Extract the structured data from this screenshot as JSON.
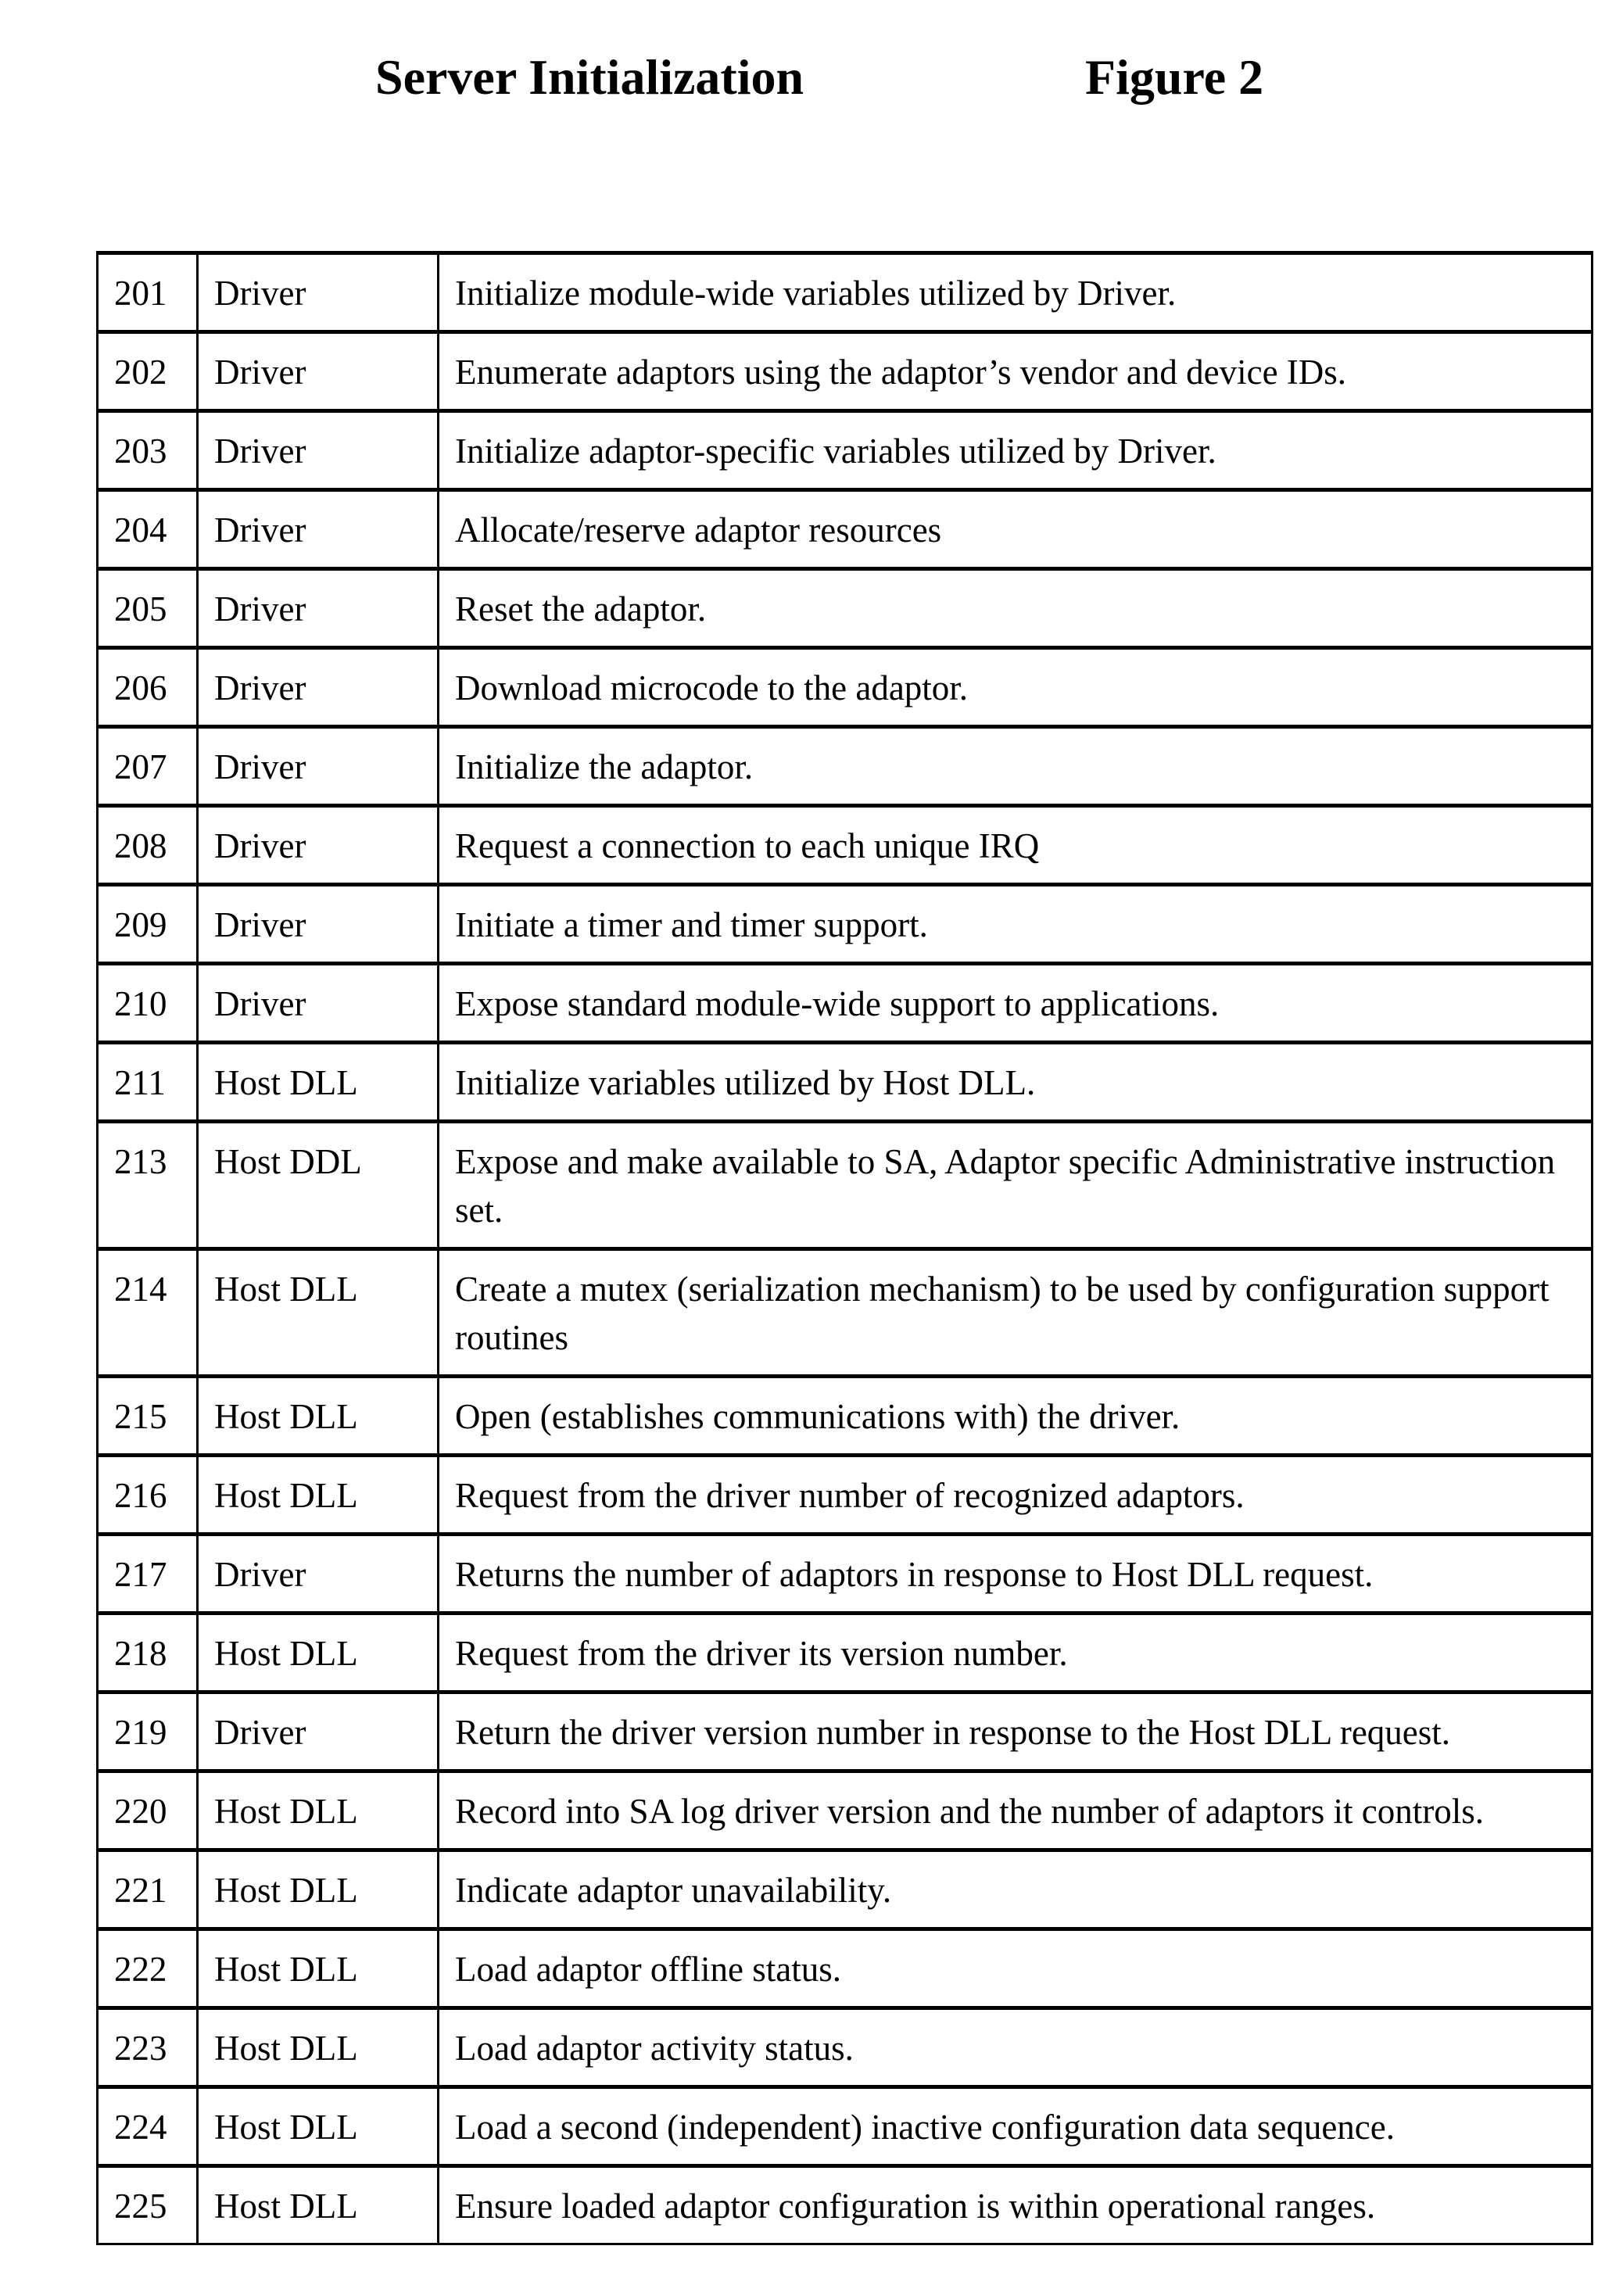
{
  "header": {
    "title": "Server Initialization",
    "figure_label": "Figure 2"
  },
  "table": {
    "rows": [
      {
        "step": "201",
        "actor": "Driver",
        "description": "Initialize module-wide variables utilized by Driver."
      },
      {
        "step": "202",
        "actor": "Driver",
        "description": "Enumerate adaptors using the adaptor’s vendor and device IDs."
      },
      {
        "step": "203",
        "actor": "Driver",
        "description": "Initialize adaptor-specific variables utilized by Driver."
      },
      {
        "step": "204",
        "actor": "Driver",
        "description": "Allocate/reserve adaptor resources"
      },
      {
        "step": "205",
        "actor": "Driver",
        "description": "Reset the adaptor."
      },
      {
        "step": "206",
        "actor": "Driver",
        "description": "Download microcode to the adaptor."
      },
      {
        "step": "207",
        "actor": "Driver",
        "description": "Initialize the adaptor."
      },
      {
        "step": "208",
        "actor": "Driver",
        "description": "Request a connection to each unique IRQ"
      },
      {
        "step": "209",
        "actor": "Driver",
        "description": "Initiate a timer and timer support."
      },
      {
        "step": "210",
        "actor": "Driver",
        "description": "Expose standard module-wide support to applications."
      },
      {
        "step": "211",
        "actor": "Host DLL",
        "description": "Initialize variables utilized by Host DLL."
      },
      {
        "step": "213",
        "actor": "Host DDL",
        "description": "Expose and make available to SA, Adaptor specific Administrative instruction set."
      },
      {
        "step": "214",
        "actor": "Host DLL",
        "description": "Create a mutex (serialization mechanism) to be used by  configuration support routines"
      },
      {
        "step": "215",
        "actor": "Host DLL",
        "description": "Open  (establishes communications with) the driver."
      },
      {
        "step": "216",
        "actor": "Host DLL",
        "description": "Request from the driver  number of recognized adaptors."
      },
      {
        "step": "217",
        "actor": "Driver",
        "description": "Returns the number of adaptors in response to Host DLL request."
      },
      {
        "step": "218",
        "actor": "Host DLL",
        "description": "Request from the driver its version number."
      },
      {
        "step": "219",
        "actor": "Driver",
        "description": "Return the driver version number in response to the Host DLL request."
      },
      {
        "step": "220",
        "actor": "Host DLL",
        "description": "Record into SA log  driver version and the number of adaptors it controls."
      },
      {
        "step": "221",
        "actor": "Host DLL",
        "description": "Indicate adaptor unavailability."
      },
      {
        "step": "222",
        "actor": "Host DLL",
        "description": "Load adaptor offline status."
      },
      {
        "step": "223",
        "actor": "Host DLL",
        "description": "Load adaptor activity status."
      },
      {
        "step": "224",
        "actor": "Host DLL",
        "description": "Load a second (independent) inactive configuration data sequence."
      },
      {
        "step": "225",
        "actor": "Host DLL",
        "description": "Ensure loaded adaptor configuration is within operational ranges."
      }
    ]
  }
}
